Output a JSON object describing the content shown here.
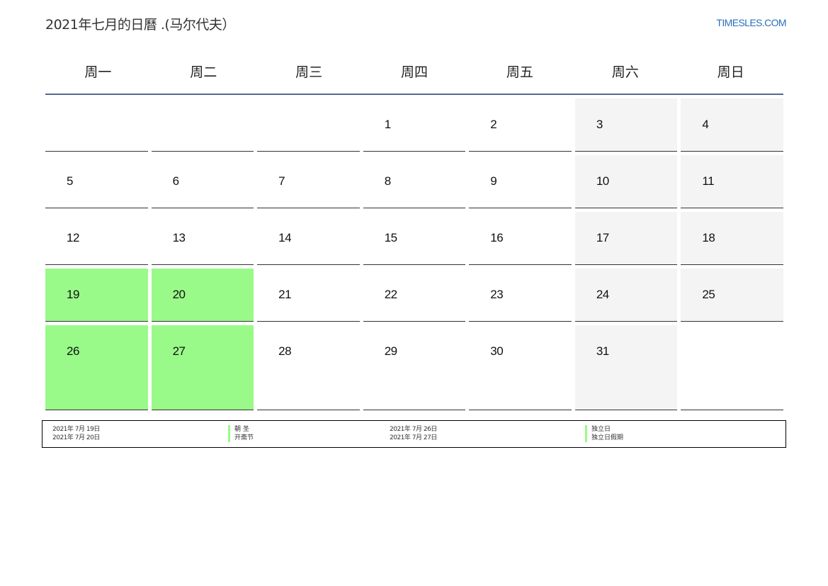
{
  "header": {
    "title": "2021年七月的日曆 .(马尔代夫）",
    "site": "TIMESLES.COM"
  },
  "weekdays": [
    "周一",
    "周二",
    "周三",
    "周四",
    "周五",
    "周六",
    "周日"
  ],
  "calendar": {
    "weeks": [
      [
        null,
        null,
        null,
        {
          "day": "1"
        },
        {
          "day": "2"
        },
        {
          "day": "3"
        },
        {
          "day": "4"
        }
      ],
      [
        {
          "day": "5"
        },
        {
          "day": "6"
        },
        {
          "day": "7"
        },
        {
          "day": "8"
        },
        {
          "day": "9"
        },
        {
          "day": "10"
        },
        {
          "day": "11"
        }
      ],
      [
        {
          "day": "12"
        },
        {
          "day": "13"
        },
        {
          "day": "14"
        },
        {
          "day": "15"
        },
        {
          "day": "16"
        },
        {
          "day": "17"
        },
        {
          "day": "18"
        }
      ],
      [
        {
          "day": "19",
          "holiday": true
        },
        {
          "day": "20",
          "holiday": true
        },
        {
          "day": "21"
        },
        {
          "day": "22"
        },
        {
          "day": "23"
        },
        {
          "day": "24"
        },
        {
          "day": "25"
        }
      ],
      [
        {
          "day": "26",
          "holiday": true
        },
        {
          "day": "27",
          "holiday": true
        },
        {
          "day": "28"
        },
        {
          "day": "29"
        },
        {
          "day": "30"
        },
        {
          "day": "31"
        },
        null
      ]
    ],
    "holiday_color": "#99fa89",
    "weekend_color": "#f4f4f4"
  },
  "legend": {
    "col1_dates": [
      "2021年 7月 19日",
      "2021年 7月 20日"
    ],
    "col1_names": [
      "朝 圣",
      "开斋节"
    ],
    "col2_dates": [
      "2021年 7月 26日",
      "2021年 7月 27日"
    ],
    "col2_names": [
      "独立日",
      "独立日假期"
    ]
  }
}
